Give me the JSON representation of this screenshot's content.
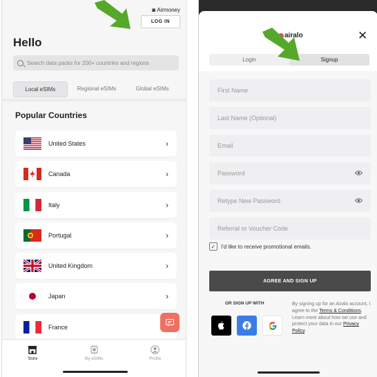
{
  "left": {
    "brand": "Airmoney",
    "login_label": "LOG IN",
    "title": "Hello",
    "search_placeholder": "Search data packs for 200+ countries and regions",
    "tabs": [
      {
        "label": "Local eSIMs",
        "active": true
      },
      {
        "label": "Regional eSIMs",
        "active": false
      },
      {
        "label": "Global eSIMs",
        "active": false
      }
    ],
    "section_title": "Popular Countries",
    "countries": [
      {
        "name": "United States"
      },
      {
        "name": "Canada"
      },
      {
        "name": "Italy"
      },
      {
        "name": "Portugal"
      },
      {
        "name": "United Kingdom"
      },
      {
        "name": "Japan"
      },
      {
        "name": "France"
      }
    ],
    "nav": [
      {
        "label": "Store",
        "icon": "store-icon",
        "active": true
      },
      {
        "label": "My eSIMs",
        "icon": "sim-icon",
        "active": false
      },
      {
        "label": "Profile",
        "icon": "profile-icon",
        "active": false
      }
    ]
  },
  "right": {
    "logo": "airalo",
    "tabs": [
      {
        "label": "Login",
        "active": false
      },
      {
        "label": "Signup",
        "active": true
      }
    ],
    "fields": {
      "first_name": "First Name",
      "last_name": "Last Name (Optional)",
      "email": "Email",
      "password": "Password",
      "retype_password": "Retype New Password",
      "referral": "Referral or Voucher Code"
    },
    "promo_label": "I'd like to receive promotional emails.",
    "agree_label": "AGREE AND SIGN UP",
    "or_with": "OR SIGN UP WITH",
    "terms_prefix": "By signing up for an Airalo account, I agree to the ",
    "terms_link": "Terms & Conditions",
    "terms_mid": ". Learn more about how we use and protect your data in our ",
    "privacy_link": "Privacy Policy",
    "terms_suffix": "."
  },
  "colors": {
    "arrow": "#55a82a",
    "chat": "#f07060",
    "agree": "#4a4a4a",
    "facebook": "#3b7ce8"
  }
}
